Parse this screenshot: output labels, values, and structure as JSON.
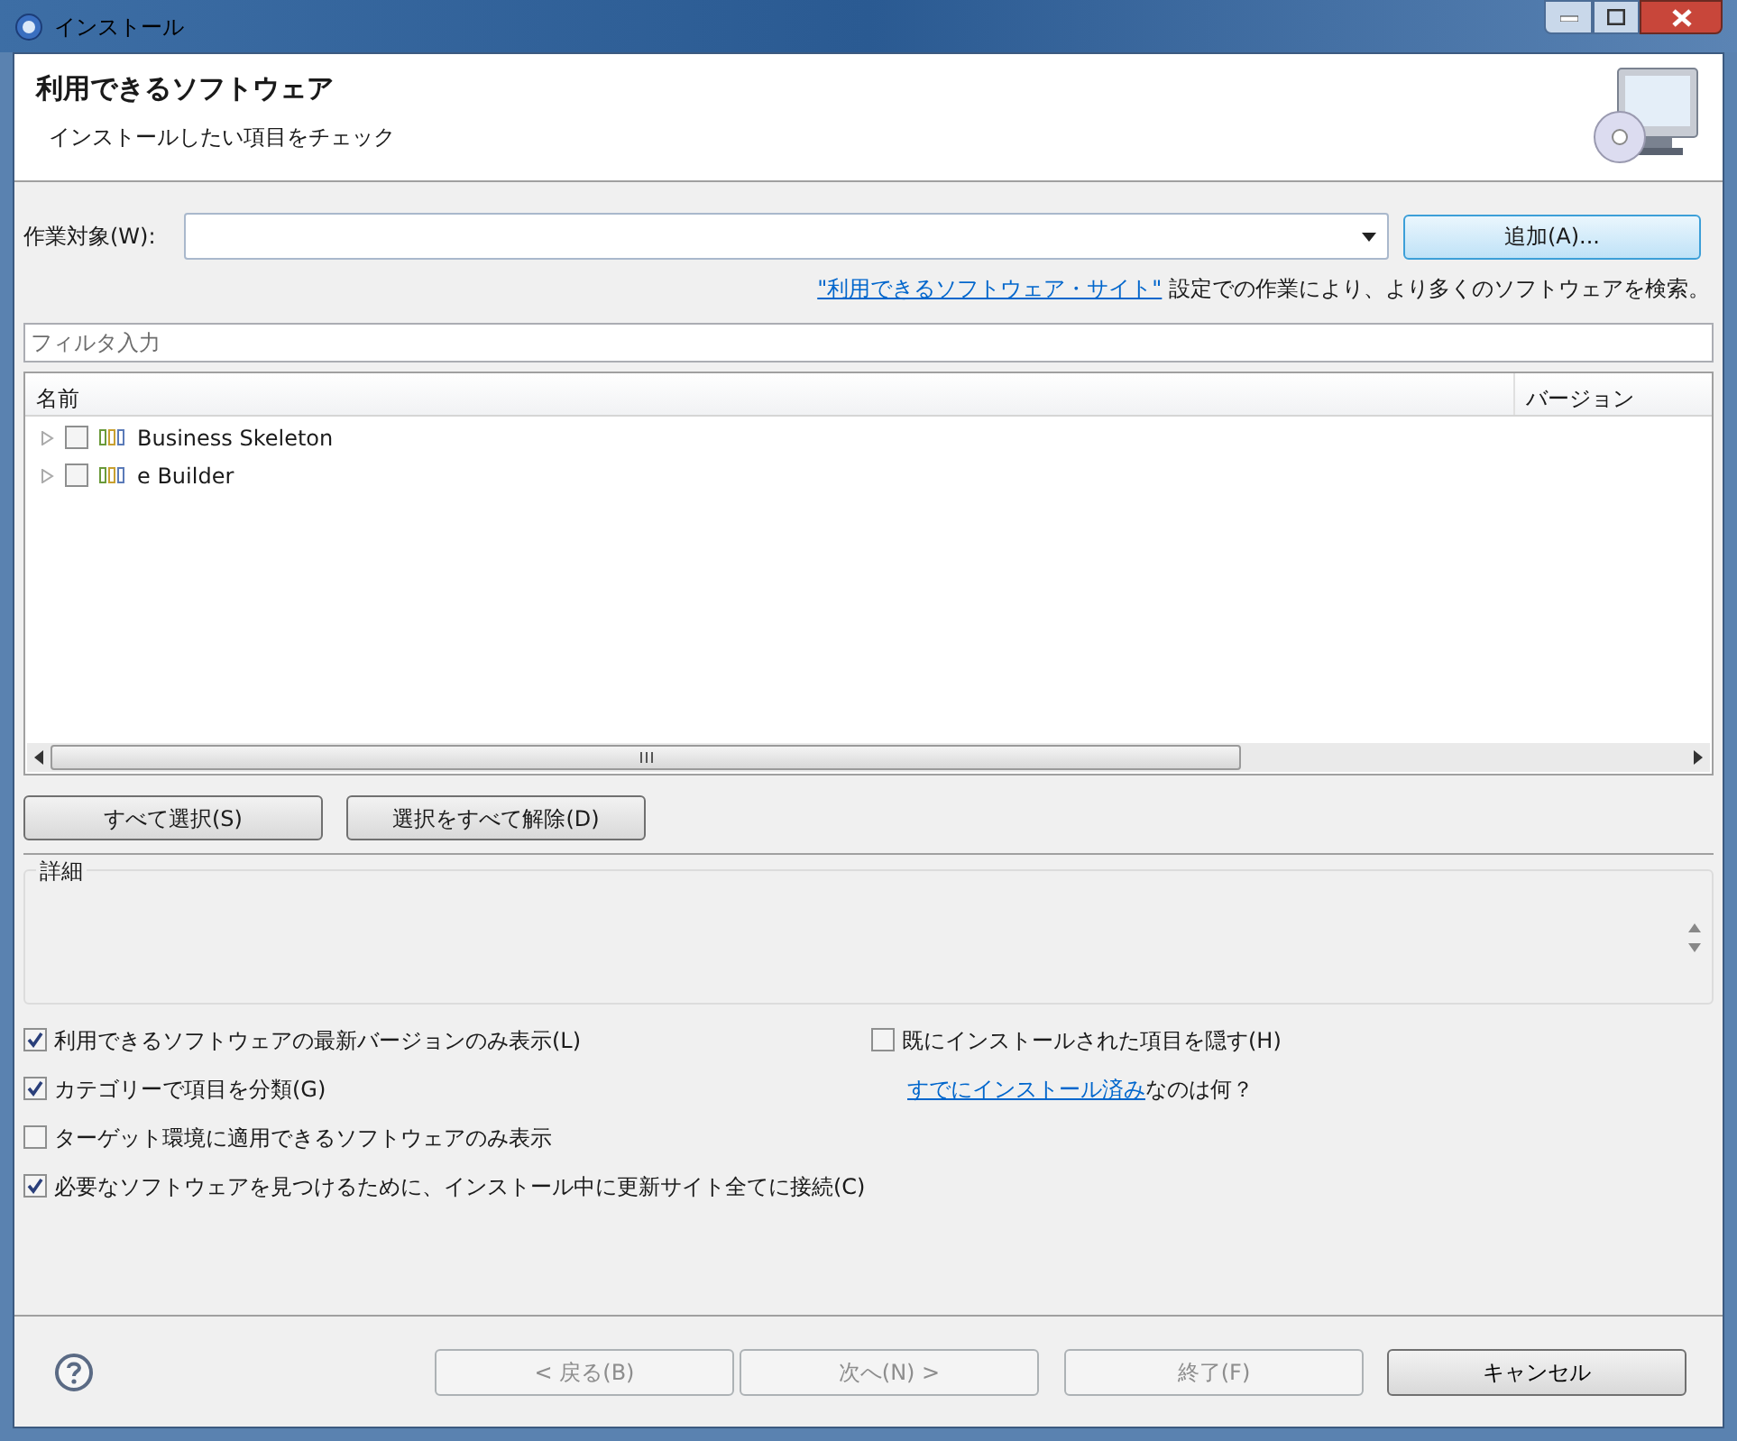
{
  "window": {
    "title": "インストール"
  },
  "header": {
    "title": "利用できるソフトウェア",
    "subtitle": "インストールしたい項目をチェック"
  },
  "work_with": {
    "label": "作業対象(W):",
    "add_button": "追加(A)..."
  },
  "site_hint": {
    "link": "\"利用できるソフトウェア・サイト\"",
    "text": " 設定での作業により、より多くのソフトウェアを検索。"
  },
  "filter": {
    "placeholder": "フィルタ入力"
  },
  "tree": {
    "columns": [
      "名前",
      "バージョン"
    ],
    "rows": [
      {
        "label": "Business Skeleton",
        "checked": false,
        "expanded": false
      },
      {
        "label": "e Builder",
        "checked": false,
        "expanded": false
      }
    ]
  },
  "selection_buttons": [
    "すべて選択(S)",
    "選択をすべて解除(D)"
  ],
  "details": {
    "title": "詳細"
  },
  "options_left": [
    {
      "label": "利用できるソフトウェアの最新バージョンのみ表示(L)",
      "checked": true
    },
    {
      "label": "カテゴリーで項目を分類(G)",
      "checked": true
    },
    {
      "label": "ターゲット環境に適用できるソフトウェアのみ表示",
      "checked": false
    },
    {
      "label": "必要なソフトウェアを見つけるために、インストール中に更新サイト全てに接続(C)",
      "checked": true
    }
  ],
  "options_right": [
    {
      "kind": "checkbox",
      "label": "既にインストールされた項目を隠す(H)",
      "checked": false
    },
    {
      "kind": "link",
      "link": "すでにインストール済み",
      "text": "なのは何？"
    }
  ],
  "footer_buttons": [
    {
      "label": "< 戻る(B)",
      "disabled": true
    },
    {
      "label": "次へ(N) >",
      "disabled": true
    },
    {
      "label": "終了(F)",
      "disabled": true
    },
    {
      "label": "キャンセル",
      "disabled": false
    }
  ]
}
